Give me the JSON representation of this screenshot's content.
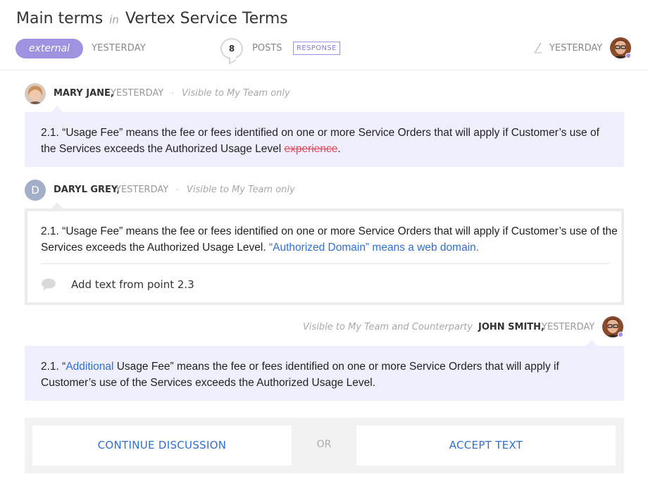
{
  "header": {
    "title_main": "Main terms",
    "title_in": "in",
    "title_doc": "Vertex Service Terms",
    "tag": "external",
    "created": "YESTERDAY",
    "posts_count": "8",
    "posts_label": "POSTS",
    "response_badge": "RESPONSE",
    "edit_icon": "pen-icon",
    "updated": "YESTERDAY"
  },
  "messages": [
    {
      "author": "MARY JANE,",
      "time": "YESTERDAY",
      "separator": "·",
      "visibility": "Visible to My Team only",
      "text_before": "2.1. “Usage Fee” means the fee or fees identified on one or more Service Orders that will apply if Customer’s use of the Services exceeds the Authorized Usage Level",
      "text_deleted": "experience",
      "text_after": "."
    },
    {
      "author": "DARYL GREY,",
      "avatar_initial": "D",
      "time": "YESTERDAY",
      "separator": "·",
      "visibility": "Visible to My Team only",
      "text_before": "2.1. “Usage Fee” means the fee or fees identified on one or more Service Orders that will apply if Customer’s use of the Services exceeds the Authorized Usage Level.",
      "text_added": "“Authorized Domain” means a web domain.",
      "comment": "Add text from point 2.3"
    },
    {
      "author": "JOHN SMITH,",
      "time": "YESTERDAY",
      "separator": "·",
      "visibility": "Visible to My Team and Counterparty",
      "text_start": "2.1. “",
      "text_added": "Additional",
      "text_rest": " Usage Fee” means the fee or fees identified on one or more Service Orders that will apply if Customer’s use of the Services exceeds the Authorized Usage Level."
    }
  ],
  "actions": {
    "continue_label": "CONTINUE DISCUSSION",
    "or_label": "OR",
    "accept_label": "ACCEPT TEXT"
  },
  "colors": {
    "accent": "#9f92e0",
    "card_bg": "#efeefd",
    "link": "#2f6fd6",
    "deleted": "#e0485a"
  }
}
